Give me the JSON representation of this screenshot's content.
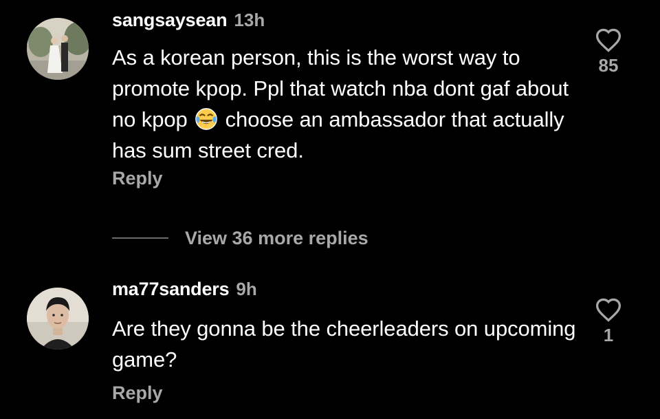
{
  "comments": [
    {
      "username": "sangsaysean",
      "time": "13h",
      "text_before_emoji": "As a korean person, this is the worst way to promote kpop. Ppl that watch nba dont gaf about no kpop",
      "emoji": "face-with-tears-of-joy",
      "text_after_emoji": " choose an ambassador that actually has sum street cred.",
      "reply_label": "Reply",
      "likes": "85",
      "avatar": "wedding-couple-photo"
    },
    {
      "username": "ma77sanders",
      "time": "9h",
      "text": "Are they gonna be the cheerleaders on upcoming game?",
      "reply_label": "Reply",
      "likes": "1",
      "avatar": "man-portrait-photo"
    }
  ],
  "view_replies_label": "View 36 more replies",
  "colors": {
    "background": "#000000",
    "primary_text": "#ffffff",
    "secondary_text": "#a8a8a8"
  },
  "icons": {
    "like": "heart-outline-icon"
  }
}
